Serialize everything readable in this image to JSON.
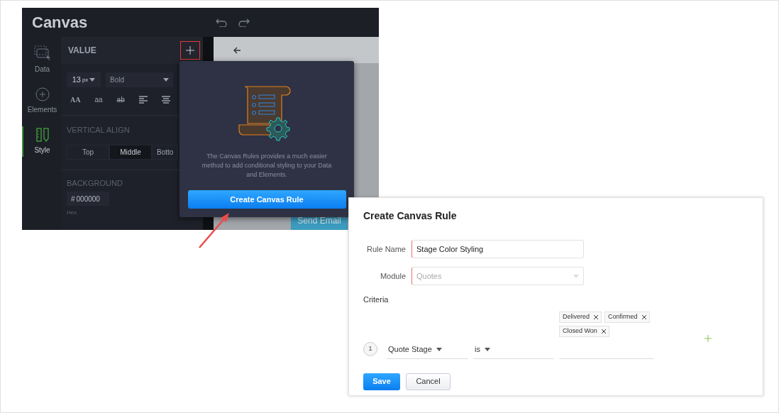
{
  "editor": {
    "logo": "Canvas",
    "nav": [
      {
        "label": "Data",
        "selected": false
      },
      {
        "label": "Elements",
        "selected": false
      },
      {
        "label": "Style",
        "selected": true
      }
    ],
    "panel": {
      "section_title": "VALUE",
      "font_size": "13",
      "font_unit": "px",
      "font_weight": "Bold",
      "text_styles": [
        "AA",
        "aa",
        "ab"
      ],
      "vertical_align": {
        "title": "VERTICAL ALIGN",
        "options": [
          {
            "label": "Top",
            "selected": false
          },
          {
            "label": "Middle",
            "selected": true
          },
          {
            "label": "Botto",
            "selected": false
          }
        ]
      },
      "background": {
        "title": "BACKGROUND",
        "prefix": "#",
        "value": "000000",
        "caption": "Hex"
      }
    },
    "canvas": {
      "button": "Send Email"
    }
  },
  "popup": {
    "text": "The Canvas Rules provides a much easier method to add conditional styling to your Data and Elements.",
    "button": "Create Canvas Rule"
  },
  "dialog": {
    "title": "Create Canvas Rule",
    "fields": [
      {
        "label": "Rule Name",
        "value": "Stage Color Styling",
        "kind": "text",
        "disabled": false
      },
      {
        "label": "Module",
        "value": "Quotes",
        "kind": "select",
        "disabled": true
      }
    ],
    "criteria_label": "Criteria",
    "criteria": [
      {
        "number": "1",
        "field": "Quote Stage",
        "operator": "is",
        "values": [
          "Delivered",
          "Confirmed",
          "Closed Won"
        ]
      }
    ],
    "buttons": [
      {
        "label": "Save",
        "kind": "primary"
      },
      {
        "label": "Cancel",
        "kind": "secondary"
      }
    ]
  }
}
